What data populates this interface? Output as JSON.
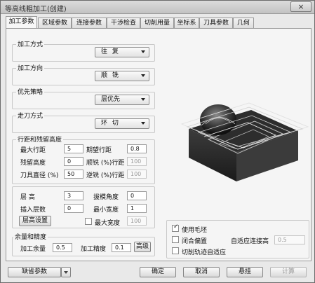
{
  "window": {
    "title": "等高线粗加工(创建)",
    "close_symbol": "×"
  },
  "tabs": [
    "加工参数",
    "区域参数",
    "连接参数",
    "干涉检查",
    "切削用量",
    "坐标系",
    "刀具参数",
    "几何"
  ],
  "machining_mode": {
    "label": "加工方式",
    "value": "往 复"
  },
  "machining_direction": {
    "label": "加工方向",
    "value": "顺 铣"
  },
  "priority_strategy": {
    "label": "优先策略",
    "value": "层优先"
  },
  "tool_path": {
    "label": "走刀方式",
    "value": "环 切"
  },
  "stepover": {
    "label": "行距和残留高度",
    "max_stepover_label": "最大行距",
    "max_stepover": "5",
    "expected_stepover_label": "期望行距",
    "expected_stepover": "0.8",
    "scallop_label": "残留高度",
    "scallop": "0",
    "climb_label": "顺铣 (%)行距",
    "climb": "100",
    "tool_dia_label": "刀具直径 (%)",
    "tool_dia": "50",
    "conventional_label": "逆铣 (%)行距",
    "conventional": "100"
  },
  "layers": {
    "layer_height_label": "层    高",
    "layer_height": "3",
    "slope_angle_label": "拔模角度",
    "slope_angle": "0",
    "insert_layers_label": "插入层数",
    "insert_layers": "0",
    "min_width_label": "最小宽度",
    "min_width": "1",
    "layer_settings_btn": "层高设置",
    "max_width_label": "最大宽度",
    "max_width": "100"
  },
  "allowance": {
    "label": "余量和精度",
    "allowance_label": "加工余量",
    "allowance": "0.5",
    "precision_label": "加工精度",
    "precision": "0.1",
    "advanced_btn": "高级"
  },
  "options": {
    "use_blank_label": "使用毛坯",
    "use_blank": true,
    "closed_offset_label": "闭合偏置",
    "closed_offset": false,
    "adaptive_label": "自适应连接高",
    "adaptive_value": "0.5",
    "trim_label": "切削轨迹自适应",
    "trim": false
  },
  "footer": {
    "default_params": "缺省参数",
    "ok": "确定",
    "cancel": "取消",
    "suspend": "悬挂",
    "compute": "计算"
  }
}
